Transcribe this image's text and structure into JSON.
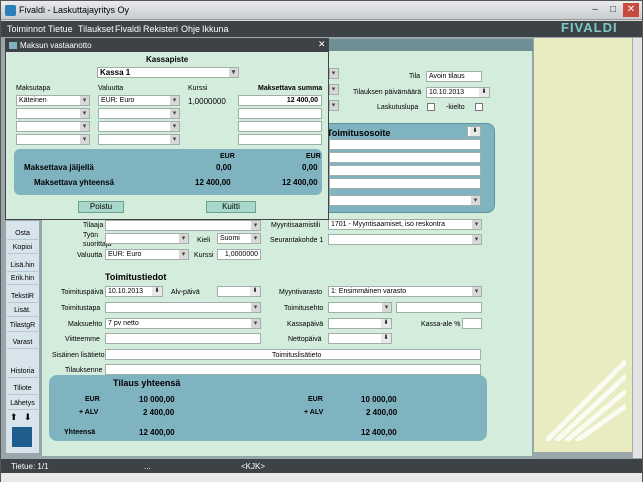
{
  "window": {
    "title": "Fivaldi - Laskuttajayritys Oy",
    "min": "–",
    "max": "□",
    "close": "✕"
  },
  "menu": [
    "Toiminnot",
    "Tietue",
    "Tilaukset",
    "Fivaldi",
    "Rekisteri",
    "Ohje",
    "Ikkuna"
  ],
  "logo": "FIVALDI",
  "header": {
    "tila_label": "Tila",
    "tila_value": "Avoin tilaus",
    "date_label": "Tilauksen päivämäärä",
    "date_value": "10.10.2013",
    "laskutuslupa_label": "Laskutuslupa",
    "kielto_label": "-kielto"
  },
  "toimitusosoite": {
    "title": "Toimitusosoite"
  },
  "mid": {
    "tilaaja_label": "Tilaaja",
    "tyon_label": "Työn suorittaja",
    "valuutta_label": "Valuutta",
    "valuutta_value": "EUR: Euro",
    "kieli_label": "Kieli",
    "kieli_value": "Suomi",
    "kurssi_label": "Kurssi",
    "kurssi_value": "1,0000000",
    "myyntisaam_label": "Myyntisaamistili",
    "myyntisaam_value": "1701 - Myyntisaamiset, iso reskontra",
    "seuranta_label": "Seurantakohde 1"
  },
  "toimitustiedot": {
    "title": "Toimitustiedot",
    "tpv_label": "Toimituspäivä",
    "tpv_value": "10.10.2013",
    "alv_label": "Alv-päivä",
    "tapa_label": "Toimitustapa",
    "maksuehto_label": "Maksuehto",
    "maksuehto_value": "7 pv netto",
    "viite_label": "Viitteemme",
    "sis_label": "Sisäinen lisätieto",
    "tilauksenne_label": "Tilauksenne",
    "varasto_label": "Myyntivarasto",
    "varasto_value": "1: Ensimmäinen varasto",
    "ehto_label": "Toimitusehto",
    "kassapv_label": "Kassapäivä",
    "kassaale_label": "Kassa-ale %",
    "netto_label": "Nettopäivä",
    "lisatieto_label": "Toimituslisätieto"
  },
  "yhteensa": {
    "title": "Tilaus yhteensä",
    "eur1": "EUR",
    "val1": "10 000,00",
    "alv1": "+ ALV",
    "alvval1": "2 400,00",
    "eur2": "EUR",
    "val2": "10 000,00",
    "alv2": "+ ALV",
    "alvval2": "2 400,00",
    "tot_label": "Yhteensä",
    "tot1": "12 400,00",
    "tot2": "12 400,00"
  },
  "side": [
    "Osta",
    "Kopioi",
    "Lisä.hin",
    "Erik.hin",
    "TekstiR",
    "Lisät.",
    "TilastgR",
    "Varast",
    "Historia",
    "Tiliote",
    "Lähetys"
  ],
  "dialog": {
    "title": "Maksun vastaanotto",
    "kassapiste_label": "Kassapiste",
    "kassa_value": "Kassa 1",
    "maksutapa_label": "Maksutapa",
    "maksutapa_value": "Käteinen",
    "valuutta_label": "Valuutta",
    "valuutta_value": "EUR: Euro",
    "kurssi_label": "Kurssi",
    "kurssi_value": "1,0000000",
    "summa_label": "Maksettava summa",
    "summa_value": "12 400,00",
    "eur_a": "EUR",
    "eur_b": "EUR",
    "jaljella_label": "Maksettava jäljellä",
    "jaljella_a": "0,00",
    "jaljella_b": "0,00",
    "yht_label": "Maksettava yhteensä",
    "yht_a": "12 400,00",
    "yht_b": "12 400,00",
    "poistu": "Poistu",
    "kuitti": "Kuitti"
  },
  "status": {
    "record": "Tietue: 1/1",
    "nav": "<KJK>"
  }
}
